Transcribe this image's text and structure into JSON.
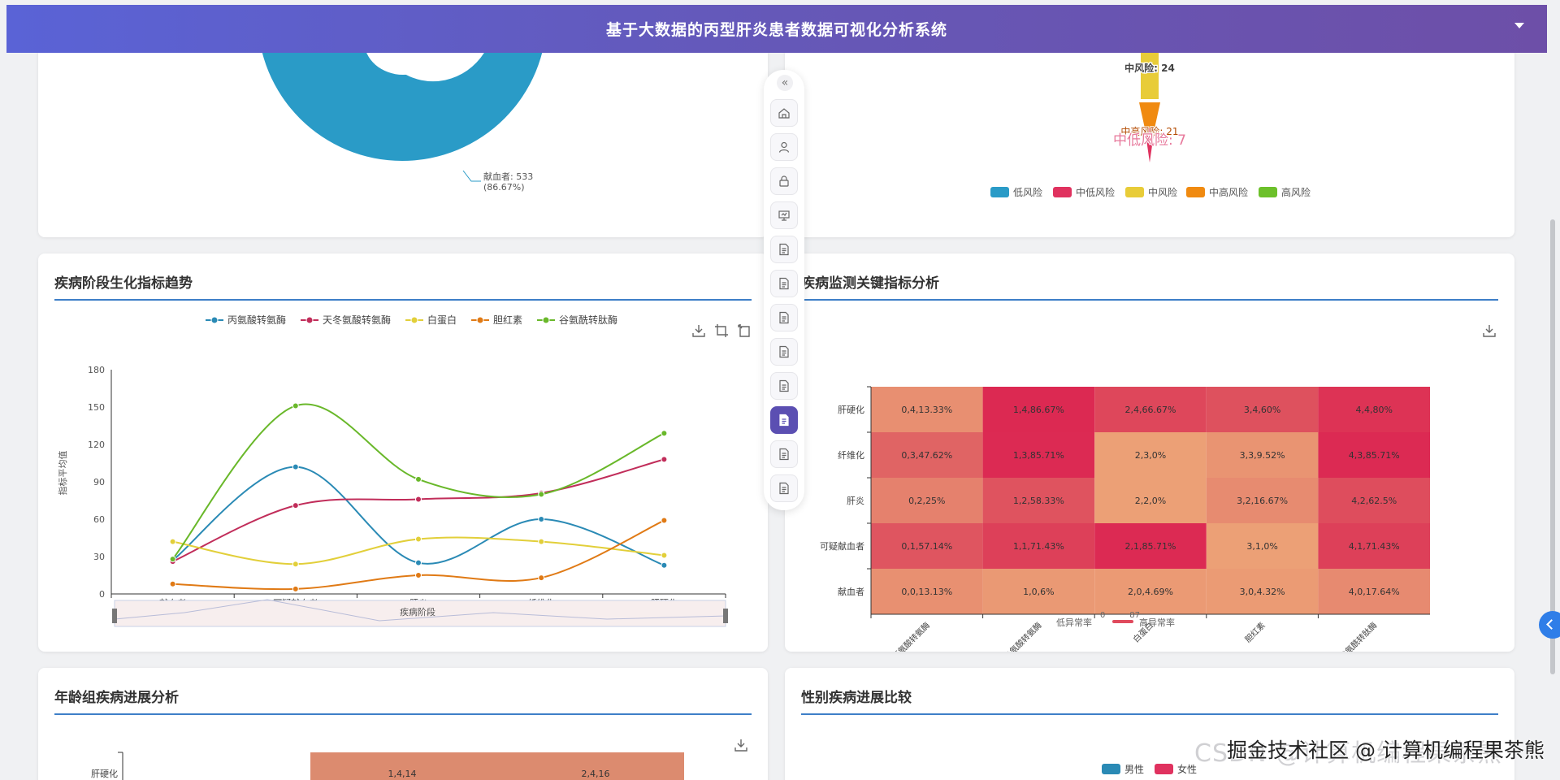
{
  "header": {
    "title": "基于大数据的丙型肝炎患者数据可视化分析系统"
  },
  "pie_card": {
    "label_name": "献血者: 533",
    "label_pct": "(86.67%)",
    "chart_data": {
      "type": "pie",
      "slices": [
        {
          "name": "献血者",
          "value": 533,
          "percent": 86.67
        }
      ]
    }
  },
  "funnel_card": {
    "labels": [
      "中风险: 24",
      "中高风险: 21",
      "中低风险: 7"
    ],
    "legend": [
      "低风险",
      "中低风险",
      "中风险",
      "中高风险",
      "高风险"
    ],
    "colors": [
      "#2a9bc7",
      "#e0325f",
      "#e8cc38",
      "#f08a10",
      "#6cc02a"
    ],
    "chart_data": {
      "type": "funnel",
      "categories": [
        "中风险",
        "中高风险",
        "中低风险"
      ],
      "values": [
        24,
        21,
        7
      ]
    }
  },
  "trend_card": {
    "title": "疾病阶段生化指标趋势",
    "xlabel": "疾病阶段",
    "ylabel": "指标平均值",
    "chart_data": {
      "type": "line",
      "categories": [
        "献血者",
        "可疑献血者",
        "肝炎",
        "纤维化",
        "肝硬化"
      ],
      "ylim": [
        0,
        180
      ],
      "yticks": [
        0,
        30,
        60,
        90,
        120,
        150,
        180
      ],
      "series": [
        {
          "name": "丙氨酸转氨酶",
          "color": "#2a8ab5",
          "values": [
            27,
            102,
            25,
            60,
            23
          ]
        },
        {
          "name": "天冬氨酸转氨酶",
          "color": "#c12d5a",
          "values": [
            26,
            71,
            76,
            81,
            108
          ]
        },
        {
          "name": "白蛋白",
          "color": "#e2cf3a",
          "values": [
            42,
            24,
            44,
            42,
            31
          ]
        },
        {
          "name": "胆红素",
          "color": "#e07a15",
          "values": [
            8,
            4,
            15,
            13,
            59
          ]
        },
        {
          "name": "谷氨酰转肽酶",
          "color": "#69b82a",
          "values": [
            28,
            151,
            92,
            80,
            129
          ]
        }
      ]
    }
  },
  "heatmap_card": {
    "title": "疾病监测关键指标分析",
    "vm_low": "低异常率",
    "vm_high": "高异常率",
    "vm_min": "0",
    "vm_max": "87",
    "chart_data": {
      "type": "heatmap",
      "rows": [
        "肝硬化",
        "纤维化",
        "肝炎",
        "可疑献血者",
        "献血者"
      ],
      "cols": [
        "丙氨酸转氨酶",
        "天冬氨酸转氨酶",
        "白蛋白",
        "胆红素",
        "谷氨酰转肽酶"
      ],
      "values": [
        [
          13.33,
          86.67,
          66.67,
          60,
          80
        ],
        [
          47.62,
          85.71,
          0,
          9.52,
          85.71
        ],
        [
          25,
          58.33,
          0,
          16.67,
          62.5
        ],
        [
          57.14,
          71.43,
          85.71,
          0,
          71.43
        ],
        [
          13.13,
          6,
          4.69,
          4.32,
          17.64
        ]
      ],
      "labels": [
        [
          "0,4,13.33%",
          "1,4,86.67%",
          "2,4,66.67%",
          "3,4,60%",
          "4,4,80%"
        ],
        [
          "0,3,47.62%",
          "1,3,85.71%",
          "2,3,0%",
          "3,3,9.52%",
          "4,3,85.71%"
        ],
        [
          "0,2,25%",
          "1,2,58.33%",
          "2,2,0%",
          "3,2,16.67%",
          "4,2,62.5%"
        ],
        [
          "0,1,57.14%",
          "1,1,71.43%",
          "2,1,85.71%",
          "3,1,0%",
          "4,1,71.43%"
        ],
        [
          "0,0,13.13%",
          "1,0,6%",
          "2,0,4.69%",
          "3,0,4.32%",
          "4,0,17.64%"
        ]
      ],
      "vmin": 0,
      "vmax": 87
    }
  },
  "age_card": {
    "title": "年龄组疾病进展分析",
    "row_label": "肝硬化",
    "cell_labels": [
      "1,4,14",
      "2,4,16"
    ]
  },
  "gender_card": {
    "title": "性别疾病进展比较",
    "legend": [
      "男性",
      "女性"
    ],
    "colors": [
      "#2a8ab5",
      "#e0325f"
    ]
  },
  "watermark": {
    "back": "CSDN @计算机编程果茶熊",
    "front": "掘金技术社区 @ 计算机编程果茶熊"
  }
}
